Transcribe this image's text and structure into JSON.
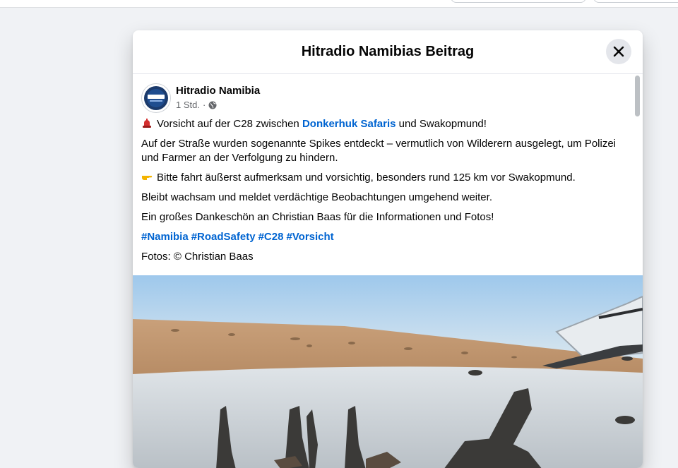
{
  "modal": {
    "title": "Hitradio Namibias Beitrag",
    "close_label": "Schließen"
  },
  "post": {
    "page_name": "Hitradio Namibia",
    "time": "1 Std.",
    "separator": "·",
    "audience_icon": "globe-icon",
    "line1": {
      "emoji_icon": "red-siren-icon",
      "before": "Vorsicht auf der C28 zwischen",
      "link": "Donkerhuk Safaris",
      "after": "und Swakopmund!"
    },
    "paragraph2": "Auf der Straße wurden sogenannte Spikes entdeckt – vermutlich von Wilderern ausgelegt, um Polizei und Farmer an der Verfolgung zu hindern.",
    "line3": {
      "emoji_icon": "pointing-hand-icon",
      "text": "Bitte fahrt äußerst aufmerksam und vorsichtig, besonders rund 125 km vor Swakopmund."
    },
    "paragraph4": "Bleibt wachsam und meldet verdächtige Beobachtungen umgehend weiter.",
    "paragraph5": "Ein großes Dankeschön an Christian Baas  für die Informationen und Fotos!",
    "hashtags": [
      "#Namibia",
      "#RoadSafety",
      "#C28",
      "#Vorsicht"
    ],
    "photo_credit": "Fotos: © Christian Baas"
  },
  "colors": {
    "link": "#0064d1",
    "background": "#f0f2f5",
    "secondary_text": "#65676b"
  }
}
